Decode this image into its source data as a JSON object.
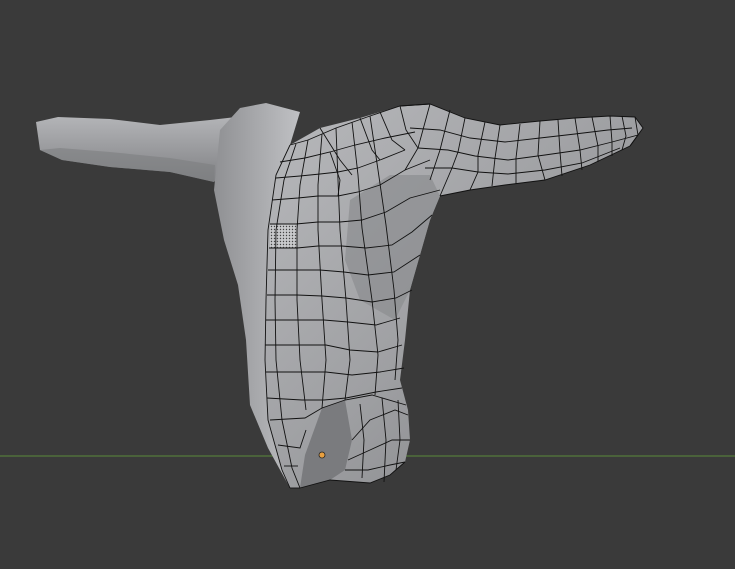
{
  "viewport": {
    "background_color": "#3a3a3a",
    "grid_floor_line_color": "#5a8a3a",
    "object_origin_color": "#e8a040"
  },
  "mesh": {
    "object": "torso-with-arm",
    "shading": "solid",
    "half_with_wireframe": "right",
    "surface_color": "#a9aaad",
    "wire_color": "#111111",
    "selected_face_pattern": "dotted"
  }
}
